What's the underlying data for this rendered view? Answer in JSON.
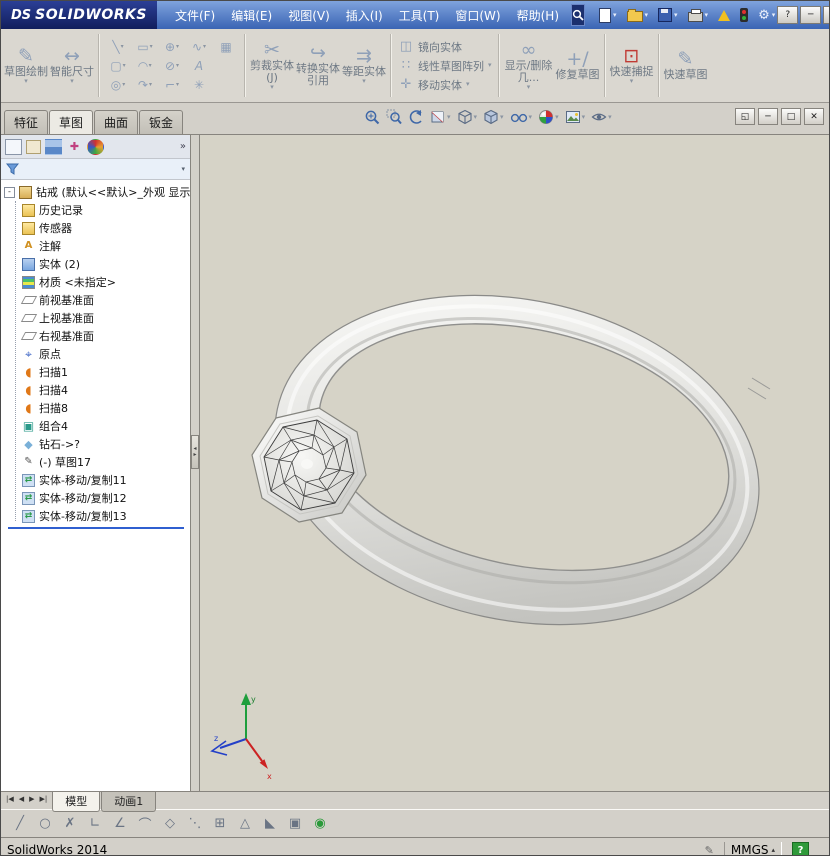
{
  "titlebar": {
    "logo_ds": "DS",
    "logo_text": "SOLIDWORKS",
    "menus": [
      "文件(F)",
      "编辑(E)",
      "视图(V)",
      "插入(I)",
      "工具(T)",
      "窗口(W)",
      "帮助(H)"
    ],
    "buttons": {
      "help": "?",
      "min": "─",
      "restore": "□",
      "close": "✕"
    }
  },
  "ribbon": {
    "sketch_label": "草图绘制",
    "smart_dim_label": "智能尺寸",
    "trim_label": "剪裁实体(J)",
    "convert_label": "转换实体引用",
    "offset_label": "等距实体",
    "mirror_label": "镜向实体",
    "pattern_label": "线性草图阵列",
    "move_label": "移动实体",
    "display_label": "显示/删除几...",
    "repair_label": "修复草图",
    "snap_label": "快速捕捉",
    "rapid_label": "快速草图",
    "icons": {
      "pencil": "✎",
      "dim": "↔",
      "r1": [
        "╲",
        "▭",
        "⊕",
        "∿",
        "▦"
      ],
      "r2": [
        "▢",
        "◠",
        "⊘",
        "A"
      ],
      "r3": [
        "◎",
        "↷",
        "⌐",
        "✳"
      ],
      "trim": "✂",
      "convert": "↪",
      "offset": "⇉",
      "mirror": "◫",
      "pattern": "∷",
      "move": "✛",
      "display": "∞",
      "repair": "+/",
      "snap": "⊡",
      "rapid": "✎"
    }
  },
  "tabs": [
    {
      "label": "特征"
    },
    {
      "label": "草图"
    },
    {
      "label": "曲面"
    },
    {
      "label": "钣金"
    }
  ],
  "headsup_icons": [
    "zoom-fit",
    "zoom-area",
    "previous-view",
    "section-view",
    "view-orientation",
    "display-style",
    "hide-show-items",
    "edit-appearance",
    "apply-scene",
    "view-settings"
  ],
  "tree": {
    "root": "钻戒 (默认<<默认>_外观 显示...",
    "items": [
      {
        "label": "历史记录",
        "icon": "history-folder"
      },
      {
        "label": "传感器",
        "icon": "sensors-folder"
      },
      {
        "label": "注解",
        "icon": "annotations"
      },
      {
        "label": "实体 (2)",
        "icon": "solid-bodies-folder"
      },
      {
        "label": "材质 <未指定>",
        "icon": "material"
      },
      {
        "label": "前视基准面",
        "icon": "plane"
      },
      {
        "label": "上视基准面",
        "icon": "plane"
      },
      {
        "label": "右视基准面",
        "icon": "plane"
      },
      {
        "label": "原点",
        "icon": "origin"
      },
      {
        "label": "扫描1",
        "icon": "sweep"
      },
      {
        "label": "扫描4",
        "icon": "sweep"
      },
      {
        "label": "扫描8",
        "icon": "sweep"
      },
      {
        "label": "组合4",
        "icon": "combine"
      },
      {
        "label": "钻石->?",
        "icon": "body"
      },
      {
        "label": "(-) 草图17",
        "icon": "sketch"
      },
      {
        "label": "实体-移动/复制11",
        "icon": "move-copy"
      },
      {
        "label": "实体-移动/复制12",
        "icon": "move-copy"
      },
      {
        "label": "实体-移动/复制13",
        "icon": "move-copy"
      }
    ]
  },
  "triad": {
    "x": "x",
    "y": "y",
    "z": "z"
  },
  "doc_tabs": [
    {
      "label": "模型"
    },
    {
      "label": "动画1"
    }
  ],
  "bottom_tools": [
    "╱",
    "○",
    "✗",
    "∟",
    "∠",
    "⌒",
    "◇",
    "⋱",
    "⊞",
    "△",
    "◣",
    "▣",
    "◉"
  ],
  "statusbar": {
    "app": "SolidWorks 2014",
    "units": "MMGS",
    "help": "?"
  }
}
